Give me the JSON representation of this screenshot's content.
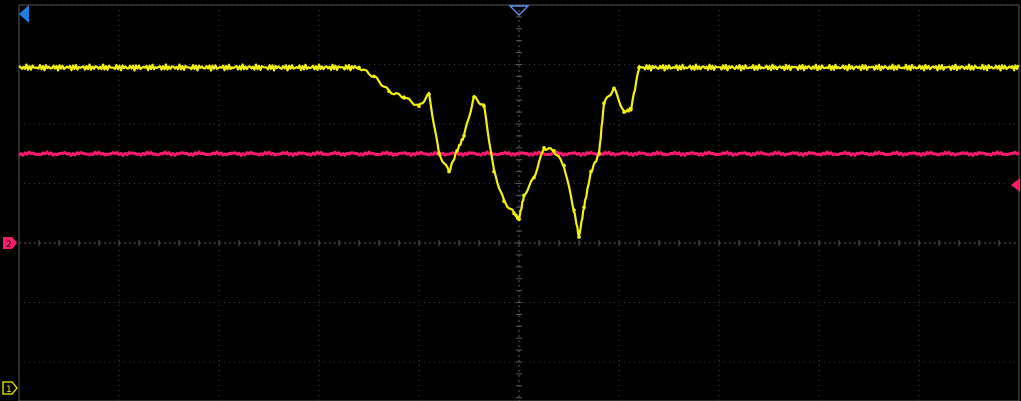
{
  "display": {
    "background": "#000000",
    "grid_color": "#3c3c3c",
    "axis_color": "#5a5a5a",
    "divisions": {
      "horizontal": 10,
      "vertical": 8
    }
  },
  "channels": [
    {
      "id": "CH1",
      "marker_label": "1",
      "color": "#f2f20a",
      "marker_icon": "ground-marker-chevron"
    },
    {
      "id": "CH2",
      "marker_label": "2",
      "color": "#ff1a6e",
      "marker_icon": "ground-marker-chevron"
    }
  ],
  "markers": {
    "trigger_position_icon": "down-triangle-outline",
    "trigger_position_color": "#5a8fe8",
    "left_offset_icon": "left-triangle",
    "left_offset_color": "#1f7fe0",
    "trigger_level_icon": "left-triangle",
    "trigger_level_color": "#ff1a6e"
  },
  "waveforms": {
    "ch1": {
      "description_shape": "flat-high-with-central-dip",
      "high_level_div": -2.95,
      "dip_points": [
        [
          -1.6,
          -2.95
        ],
        [
          -1.45,
          -2.8
        ],
        [
          -1.3,
          -2.55
        ],
        [
          -1.15,
          -2.45
        ],
        [
          -1.0,
          -2.3
        ],
        [
          -0.9,
          -2.5
        ],
        [
          -0.8,
          -1.5
        ],
        [
          -0.7,
          -1.2
        ],
        [
          -0.62,
          -1.55
        ],
        [
          -0.55,
          -1.8
        ],
        [
          -0.45,
          -2.45
        ],
        [
          -0.35,
          -2.3
        ],
        [
          -0.25,
          -1.2
        ],
        [
          -0.15,
          -0.7
        ],
        [
          -0.05,
          -0.5
        ],
        [
          0.0,
          -0.4
        ],
        [
          0.05,
          -0.8
        ],
        [
          0.15,
          -1.1
        ],
        [
          0.25,
          -1.6
        ],
        [
          0.35,
          -1.55
        ],
        [
          0.45,
          -1.3
        ],
        [
          0.55,
          -0.55
        ],
        [
          0.6,
          -0.1
        ],
        [
          0.65,
          -0.6
        ],
        [
          0.72,
          -1.2
        ],
        [
          0.8,
          -1.5
        ],
        [
          0.85,
          -2.35
        ],
        [
          0.95,
          -2.6
        ],
        [
          1.05,
          -2.2
        ],
        [
          1.12,
          -2.25
        ],
        [
          1.2,
          -2.95
        ]
      ]
    },
    "ch2": {
      "description_shape": "flat",
      "level_div": -1.5
    }
  }
}
